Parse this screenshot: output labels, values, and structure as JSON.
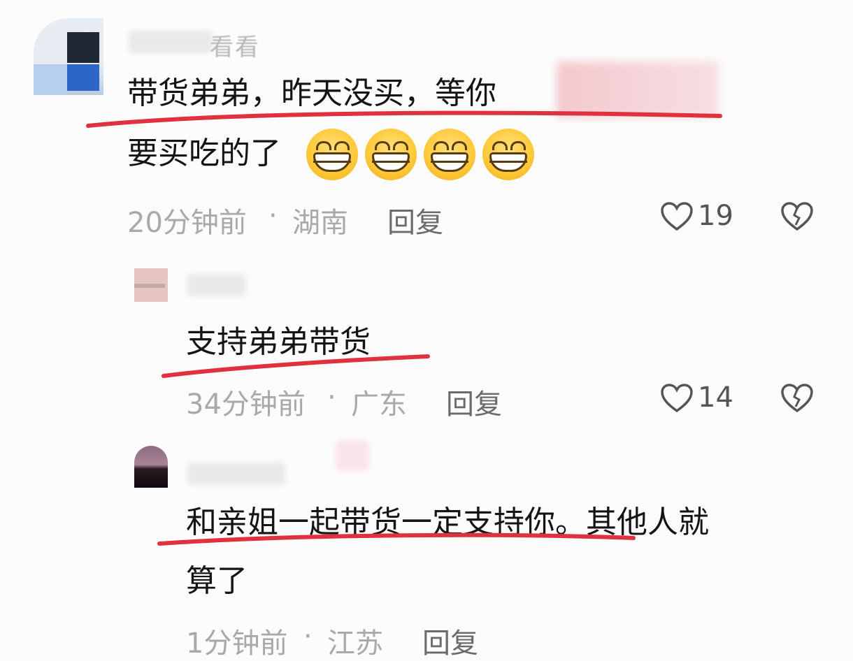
{
  "comments": [
    {
      "username": "看看",
      "text_line1": "带货弟弟，昨天没买，等你",
      "text_line2": "要买吃的了",
      "time": "20分钟前",
      "separator": "·",
      "location": "湖南",
      "reply": "回复",
      "likes": "19",
      "emoji_count": 4
    },
    {
      "username": "",
      "text_line1": "支持弟弟带货",
      "time": "34分钟前",
      "separator": "·",
      "location": "广东",
      "reply": "回复",
      "likes": "14"
    },
    {
      "username": "",
      "text_line1": "和亲姐一起带货一定支持你。其他人就",
      "text_line2": "算了",
      "time": "1分钟前",
      "separator": "·",
      "location": "江苏",
      "reply": "回复"
    }
  ],
  "icons": {
    "like": "heart-outline-icon",
    "dislike": "broken-heart-icon",
    "emoji": "grinning-face-emoji"
  },
  "colors": {
    "underline": "#e0313f",
    "meta": "#a9a9a9",
    "reply": "#6b6b6b"
  }
}
